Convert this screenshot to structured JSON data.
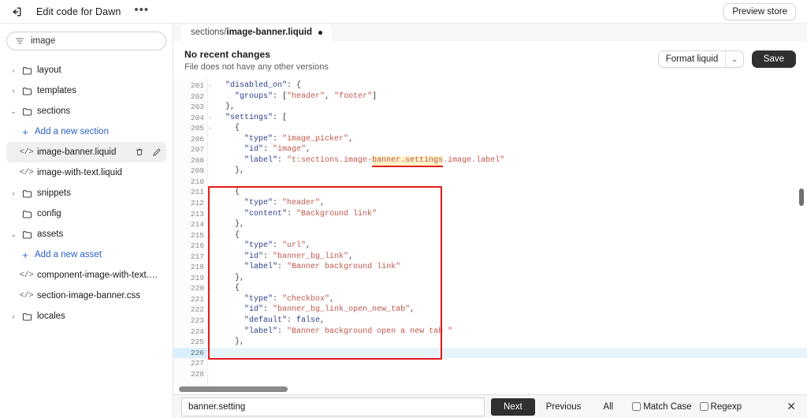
{
  "topbar": {
    "back_icon": "exit-back-icon",
    "title": "Edit code for Dawn",
    "more_label": "•••",
    "preview_label": "Preview store"
  },
  "sidebar": {
    "filter": {
      "icon": "filter-icon",
      "value": "image"
    },
    "tree": [
      {
        "kind": "folder",
        "label": "layout",
        "chevron": "›",
        "expanded": false,
        "indent": 0
      },
      {
        "kind": "folder",
        "label": "templates",
        "chevron": "›",
        "expanded": false,
        "indent": 0
      },
      {
        "kind": "folder",
        "label": "sections",
        "chevron": "⌄",
        "expanded": true,
        "indent": 0
      },
      {
        "kind": "add",
        "label": "Add a new section",
        "indent": 1
      },
      {
        "kind": "file",
        "label": "image-banner.liquid",
        "indent": 1,
        "selected": true,
        "actions": [
          "delete-icon",
          "rename-icon"
        ]
      },
      {
        "kind": "file",
        "label": "image-with-text.liquid",
        "indent": 1,
        "selected": false
      },
      {
        "kind": "folder",
        "label": "snippets",
        "chevron": "›",
        "expanded": false,
        "indent": 0
      },
      {
        "kind": "folder",
        "label": "config",
        "chevron": "",
        "expanded": false,
        "indent": 0
      },
      {
        "kind": "folder",
        "label": "assets",
        "chevron": "⌄",
        "expanded": true,
        "indent": 0
      },
      {
        "kind": "add",
        "label": "Add a new asset",
        "indent": 1
      },
      {
        "kind": "file",
        "label": "component-image-with-text.css",
        "indent": 1,
        "selected": false
      },
      {
        "kind": "file",
        "label": "section-image-banner.css",
        "indent": 1,
        "selected": false
      },
      {
        "kind": "folder",
        "label": "locales",
        "chevron": "›",
        "expanded": false,
        "indent": 0
      }
    ]
  },
  "editor": {
    "tab": {
      "folder": "sections/",
      "file": "image-banner.liquid",
      "dirty": true
    },
    "head_title": "No recent changes",
    "head_sub": "File does not have any other versions",
    "format_label": "Format liquid",
    "format_caret": "⌄",
    "save_label": "Save",
    "first_line": 201,
    "current_line": 226,
    "lines": [
      {
        "n": 201,
        "fold": true,
        "tokens": [
          {
            "t": "  ",
            "c": "p"
          },
          {
            "t": "\"disabled_on\"",
            "c": "k"
          },
          {
            "t": ": {",
            "c": "p"
          }
        ]
      },
      {
        "n": 202,
        "fold": false,
        "tokens": [
          {
            "t": "    ",
            "c": "p"
          },
          {
            "t": "\"groups\"",
            "c": "k"
          },
          {
            "t": ": [",
            "c": "p"
          },
          {
            "t": "\"header\"",
            "c": "s"
          },
          {
            "t": ", ",
            "c": "p"
          },
          {
            "t": "\"footer\"",
            "c": "s"
          },
          {
            "t": "]",
            "c": "p"
          }
        ]
      },
      {
        "n": 203,
        "fold": false,
        "tokens": [
          {
            "t": "  },",
            "c": "p"
          }
        ]
      },
      {
        "n": 204,
        "fold": true,
        "tokens": [
          {
            "t": "  ",
            "c": "p"
          },
          {
            "t": "\"settings\"",
            "c": "k"
          },
          {
            "t": ": [",
            "c": "p"
          }
        ]
      },
      {
        "n": 205,
        "fold": true,
        "tokens": [
          {
            "t": "    {",
            "c": "p"
          }
        ]
      },
      {
        "n": 206,
        "fold": false,
        "tokens": [
          {
            "t": "      ",
            "c": "p"
          },
          {
            "t": "\"type\"",
            "c": "k"
          },
          {
            "t": ": ",
            "c": "p"
          },
          {
            "t": "\"image_picker\"",
            "c": "s"
          },
          {
            "t": ",",
            "c": "p"
          }
        ]
      },
      {
        "n": 207,
        "fold": false,
        "tokens": [
          {
            "t": "      ",
            "c": "p"
          },
          {
            "t": "\"id\"",
            "c": "k"
          },
          {
            "t": ": ",
            "c": "p"
          },
          {
            "t": "\"image\"",
            "c": "s"
          },
          {
            "t": ",",
            "c": "p"
          }
        ]
      },
      {
        "n": 208,
        "fold": false,
        "tokens": [
          {
            "t": "      ",
            "c": "p"
          },
          {
            "t": "\"label\"",
            "c": "k"
          },
          {
            "t": ": ",
            "c": "p"
          },
          {
            "t": "\"t:sections.image-",
            "c": "s"
          },
          {
            "t": "banner.settings",
            "c": "s hl ul"
          },
          {
            "t": ".image.label\"",
            "c": "s"
          }
        ]
      },
      {
        "n": 209,
        "fold": false,
        "tokens": [
          {
            "t": "    },",
            "c": "p"
          }
        ]
      },
      {
        "n": 210,
        "fold": false,
        "tokens": []
      },
      {
        "n": 211,
        "fold": true,
        "tokens": [
          {
            "t": "    {",
            "c": "p"
          }
        ]
      },
      {
        "n": 212,
        "fold": false,
        "tokens": [
          {
            "t": "      ",
            "c": "p"
          },
          {
            "t": "\"type\"",
            "c": "k"
          },
          {
            "t": ": ",
            "c": "p"
          },
          {
            "t": "\"header\"",
            "c": "s"
          },
          {
            "t": ",",
            "c": "p"
          }
        ]
      },
      {
        "n": 213,
        "fold": false,
        "tokens": [
          {
            "t": "      ",
            "c": "p"
          },
          {
            "t": "\"content\"",
            "c": "k"
          },
          {
            "t": ": ",
            "c": "p"
          },
          {
            "t": "\"Background link\"",
            "c": "s"
          }
        ]
      },
      {
        "n": 214,
        "fold": false,
        "tokens": [
          {
            "t": "    },",
            "c": "p"
          }
        ]
      },
      {
        "n": 215,
        "fold": true,
        "tokens": [
          {
            "t": "    {",
            "c": "p"
          }
        ]
      },
      {
        "n": 216,
        "fold": false,
        "tokens": [
          {
            "t": "      ",
            "c": "p"
          },
          {
            "t": "\"type\"",
            "c": "k"
          },
          {
            "t": ": ",
            "c": "p"
          },
          {
            "t": "\"url\"",
            "c": "s"
          },
          {
            "t": ",",
            "c": "p"
          }
        ]
      },
      {
        "n": 217,
        "fold": false,
        "tokens": [
          {
            "t": "      ",
            "c": "p"
          },
          {
            "t": "\"id\"",
            "c": "k"
          },
          {
            "t": ": ",
            "c": "p"
          },
          {
            "t": "\"banner_bg_link\"",
            "c": "s"
          },
          {
            "t": ",",
            "c": "p"
          }
        ]
      },
      {
        "n": 218,
        "fold": false,
        "tokens": [
          {
            "t": "      ",
            "c": "p"
          },
          {
            "t": "\"label\"",
            "c": "k"
          },
          {
            "t": ": ",
            "c": "p"
          },
          {
            "t": "\"Banner background link\"",
            "c": "s"
          }
        ]
      },
      {
        "n": 219,
        "fold": false,
        "tokens": [
          {
            "t": "    },",
            "c": "p"
          }
        ]
      },
      {
        "n": 220,
        "fold": true,
        "tokens": [
          {
            "t": "    {",
            "c": "p"
          }
        ]
      },
      {
        "n": 221,
        "fold": false,
        "tokens": [
          {
            "t": "      ",
            "c": "p"
          },
          {
            "t": "\"type\"",
            "c": "k"
          },
          {
            "t": ": ",
            "c": "p"
          },
          {
            "t": "\"checkbox\"",
            "c": "s"
          },
          {
            "t": ",",
            "c": "p"
          }
        ]
      },
      {
        "n": 222,
        "fold": false,
        "tokens": [
          {
            "t": "      ",
            "c": "p"
          },
          {
            "t": "\"id\"",
            "c": "k"
          },
          {
            "t": ": ",
            "c": "p"
          },
          {
            "t": "\"banner_bg_link_open_new_tab\"",
            "c": "s"
          },
          {
            "t": ",",
            "c": "p"
          }
        ]
      },
      {
        "n": 223,
        "fold": false,
        "tokens": [
          {
            "t": "      ",
            "c": "p"
          },
          {
            "t": "\"default\"",
            "c": "k"
          },
          {
            "t": ": ",
            "c": "p"
          },
          {
            "t": "false",
            "c": "k"
          },
          {
            "t": ",",
            "c": "p"
          }
        ]
      },
      {
        "n": 224,
        "fold": false,
        "tokens": [
          {
            "t": "      ",
            "c": "p"
          },
          {
            "t": "\"label\"",
            "c": "k"
          },
          {
            "t": ": ",
            "c": "p"
          },
          {
            "t": "\"Banner background open a new tab \"",
            "c": "s"
          }
        ]
      },
      {
        "n": 225,
        "fold": false,
        "tokens": [
          {
            "t": "    },",
            "c": "p"
          }
        ]
      },
      {
        "n": 226,
        "fold": false,
        "tokens": []
      },
      {
        "n": 227,
        "fold": false,
        "tokens": []
      },
      {
        "n": 228,
        "fold": false,
        "tokens": []
      }
    ],
    "annotation": {
      "color": "#e31c1c",
      "label": "code-highlight-box"
    }
  },
  "findbar": {
    "query": "banner.setting",
    "placeholder": "",
    "next_label": "Next",
    "previous_label": "Previous",
    "all_label": "All",
    "match_case_label": "Match Case",
    "match_case_checked": false,
    "regexp_label": "Regexp",
    "regexp_checked": false,
    "close_label": "✕"
  },
  "colors": {
    "accent_link": "#2a62c6",
    "annotation_red": "#e31c1c",
    "key_navy": "#2b3f8c",
    "string_red": "#c2574b",
    "highlight_yellow": "#fdf3c6",
    "active_line": "#e8f4fb",
    "dark_button": "#303030"
  }
}
